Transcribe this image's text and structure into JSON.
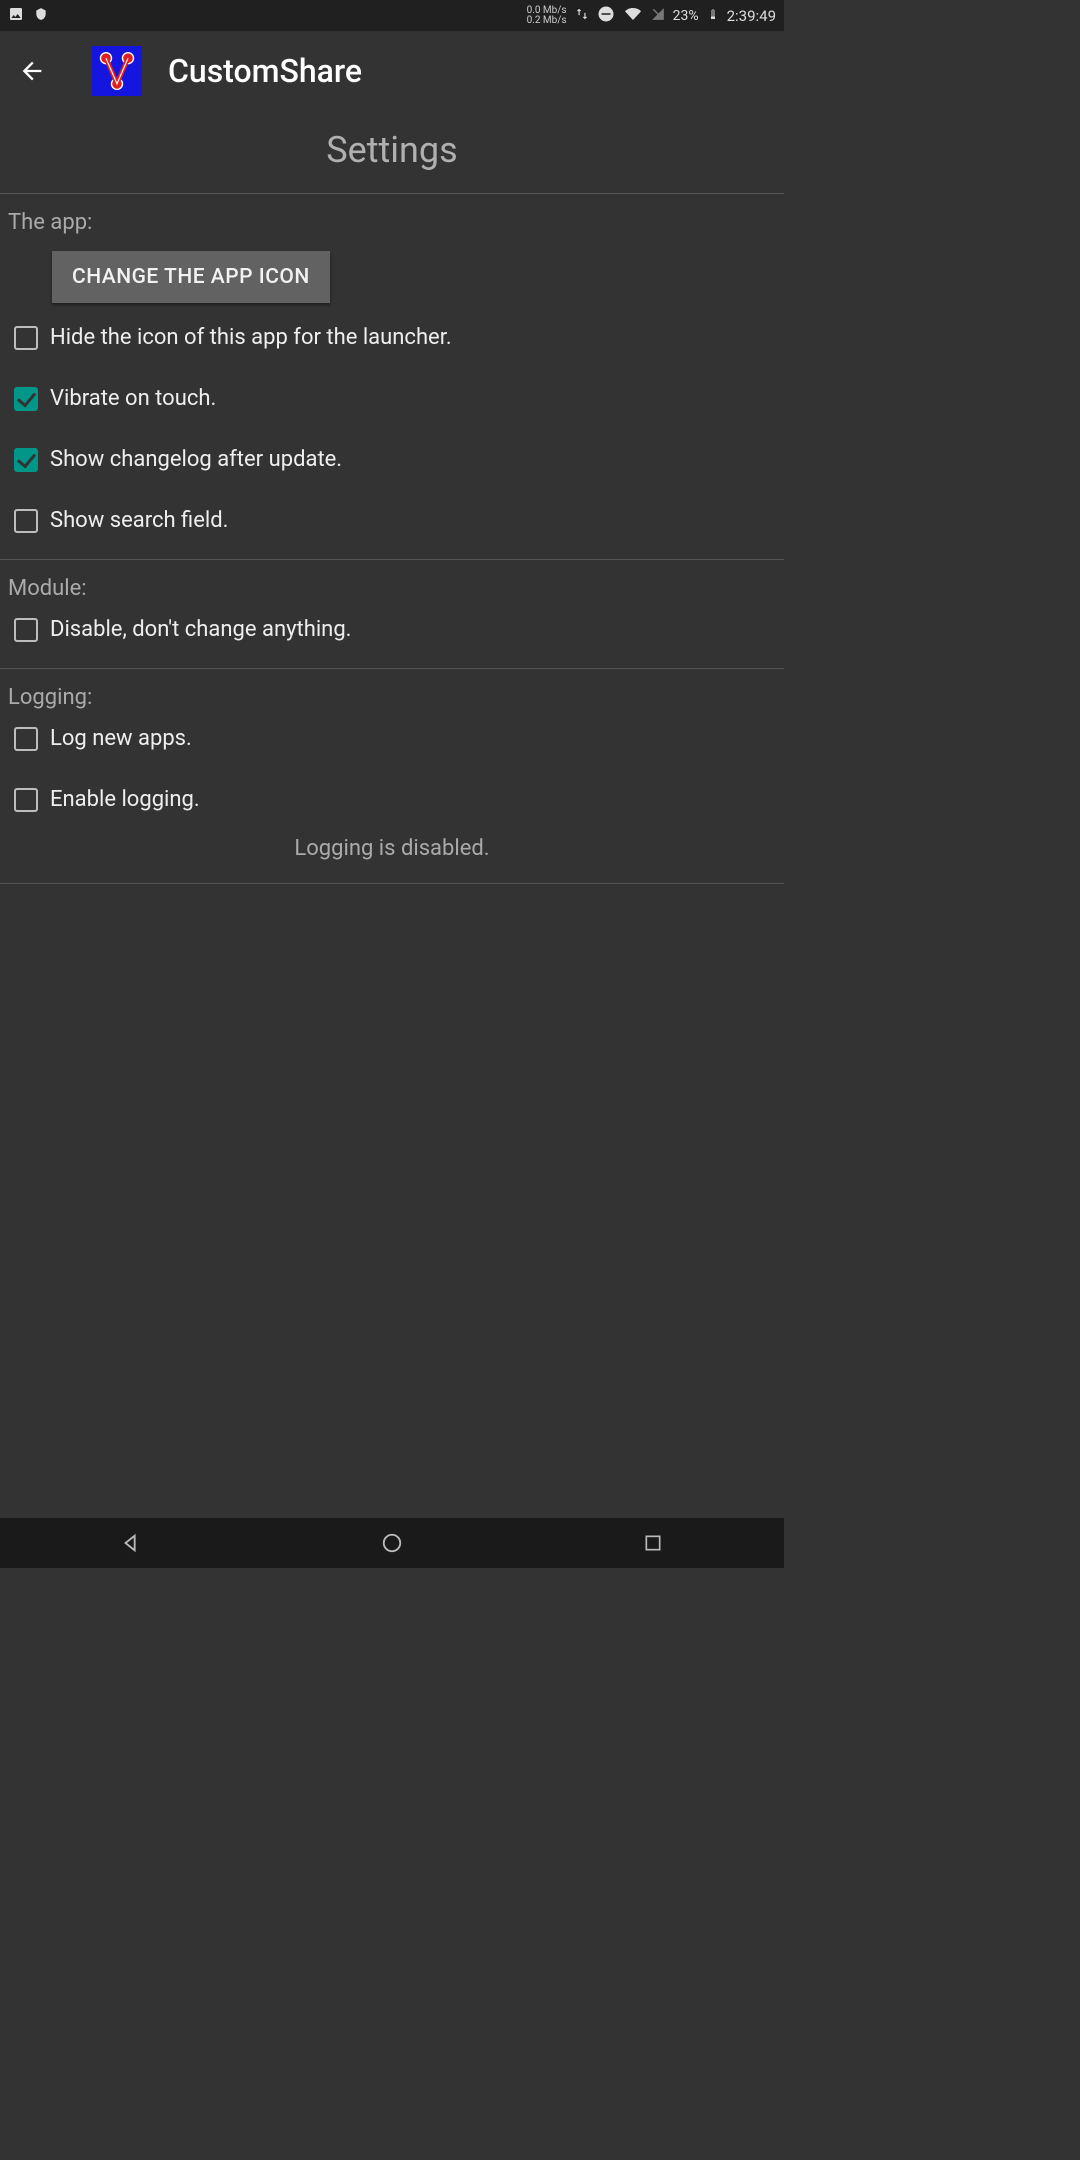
{
  "status_bar": {
    "net_up": "0.0 Mb/s",
    "net_down": "0.2 Mb/s",
    "battery": "23%",
    "time": "2:39:49"
  },
  "app_bar": {
    "title": "CustomShare"
  },
  "page_title": "Settings",
  "sections": {
    "app": {
      "label": "The app:",
      "change_icon_btn": "CHANGE THE APP ICON",
      "hide_icon": {
        "label": "Hide the icon of this app for the launcher.",
        "checked": false
      },
      "vibrate": {
        "label": "Vibrate on touch.",
        "checked": true
      },
      "changelog": {
        "label": "Show changelog after update.",
        "checked": true
      },
      "search_field": {
        "label": "Show search field.",
        "checked": false
      }
    },
    "module": {
      "label": "Module:",
      "disable": {
        "label": "Disable, don't change anything.",
        "checked": false
      }
    },
    "logging": {
      "label": "Logging:",
      "log_new": {
        "label": "Log new apps.",
        "checked": false
      },
      "enable": {
        "label": "Enable logging.",
        "checked": false
      },
      "info": "Logging is disabled."
    }
  }
}
